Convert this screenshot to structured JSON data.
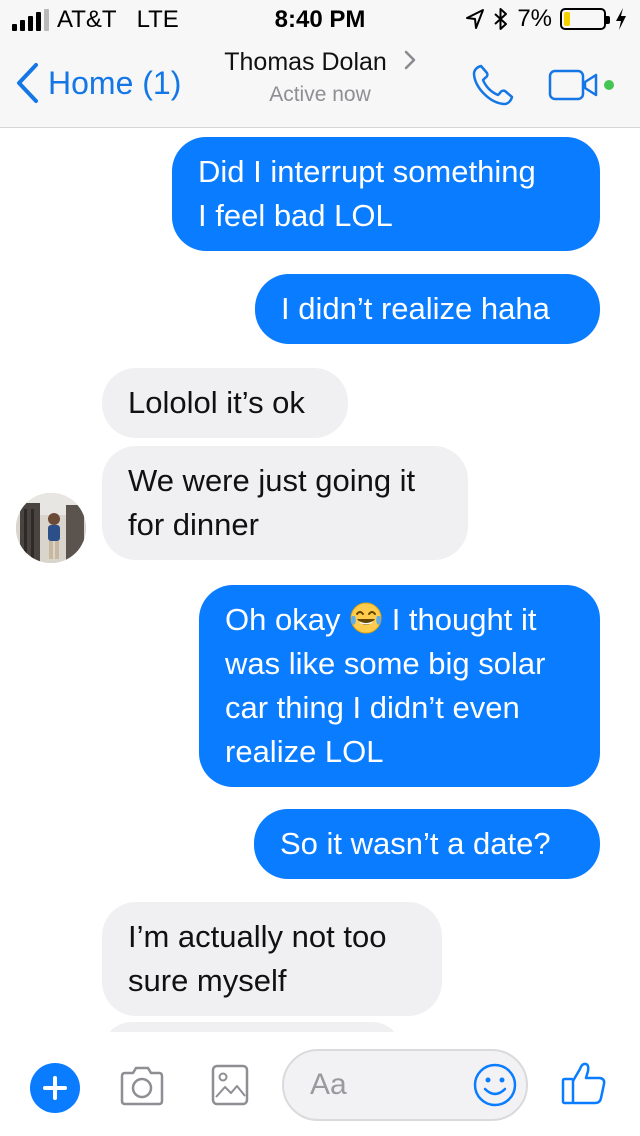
{
  "status_bar": {
    "carrier": "AT&T",
    "network": "LTE",
    "time": "8:40 PM",
    "battery_percent": "7%",
    "battery_level": 0.07,
    "signal_bars": 4,
    "icons": [
      "signal-icon",
      "location-arrow-icon",
      "bluetooth-icon",
      "battery-icon",
      "charging-bolt-icon"
    ]
  },
  "header": {
    "back_label": "Home (1)",
    "contact_name": "Thomas Dolan",
    "contact_status": "Active now",
    "icons": [
      "chevron-left-icon",
      "chevron-right-icon",
      "phone-icon",
      "video-camera-icon"
    ]
  },
  "messages": [
    {
      "side": "out",
      "lines": [
        "Did I interrupt something",
        "I feel bad LOL"
      ]
    },
    {
      "side": "out",
      "lines": [
        "I didn’t realize haha"
      ]
    },
    {
      "side": "in",
      "lines": [
        "Lololol it’s ok"
      ]
    },
    {
      "side": "in",
      "lines": [
        "We were just going it",
        "for dinner"
      ]
    },
    {
      "side": "out",
      "lines": [
        "Oh okay",
        "I thought it",
        "was like some big solar",
        "car thing I didn’t even",
        "realize LOL"
      ],
      "emoji": "tears-of-joy-emoji"
    },
    {
      "side": "out",
      "lines": [
        "So it wasn’t a date?"
      ]
    },
    {
      "side": "in",
      "lines": [
        "I’m actually not too",
        "sure myself"
      ]
    }
  ],
  "composer": {
    "placeholder": "Aa",
    "icons": [
      "plus-icon",
      "camera-icon",
      "image-icon",
      "smiley-icon",
      "thumbs-up-icon"
    ]
  },
  "colors": {
    "accent": "#0a7cff",
    "outgoing_bubble": "#0a7cff",
    "incoming_bubble": "#f0f0f2",
    "online": "#44c553",
    "battery_low": "#f6d100"
  }
}
